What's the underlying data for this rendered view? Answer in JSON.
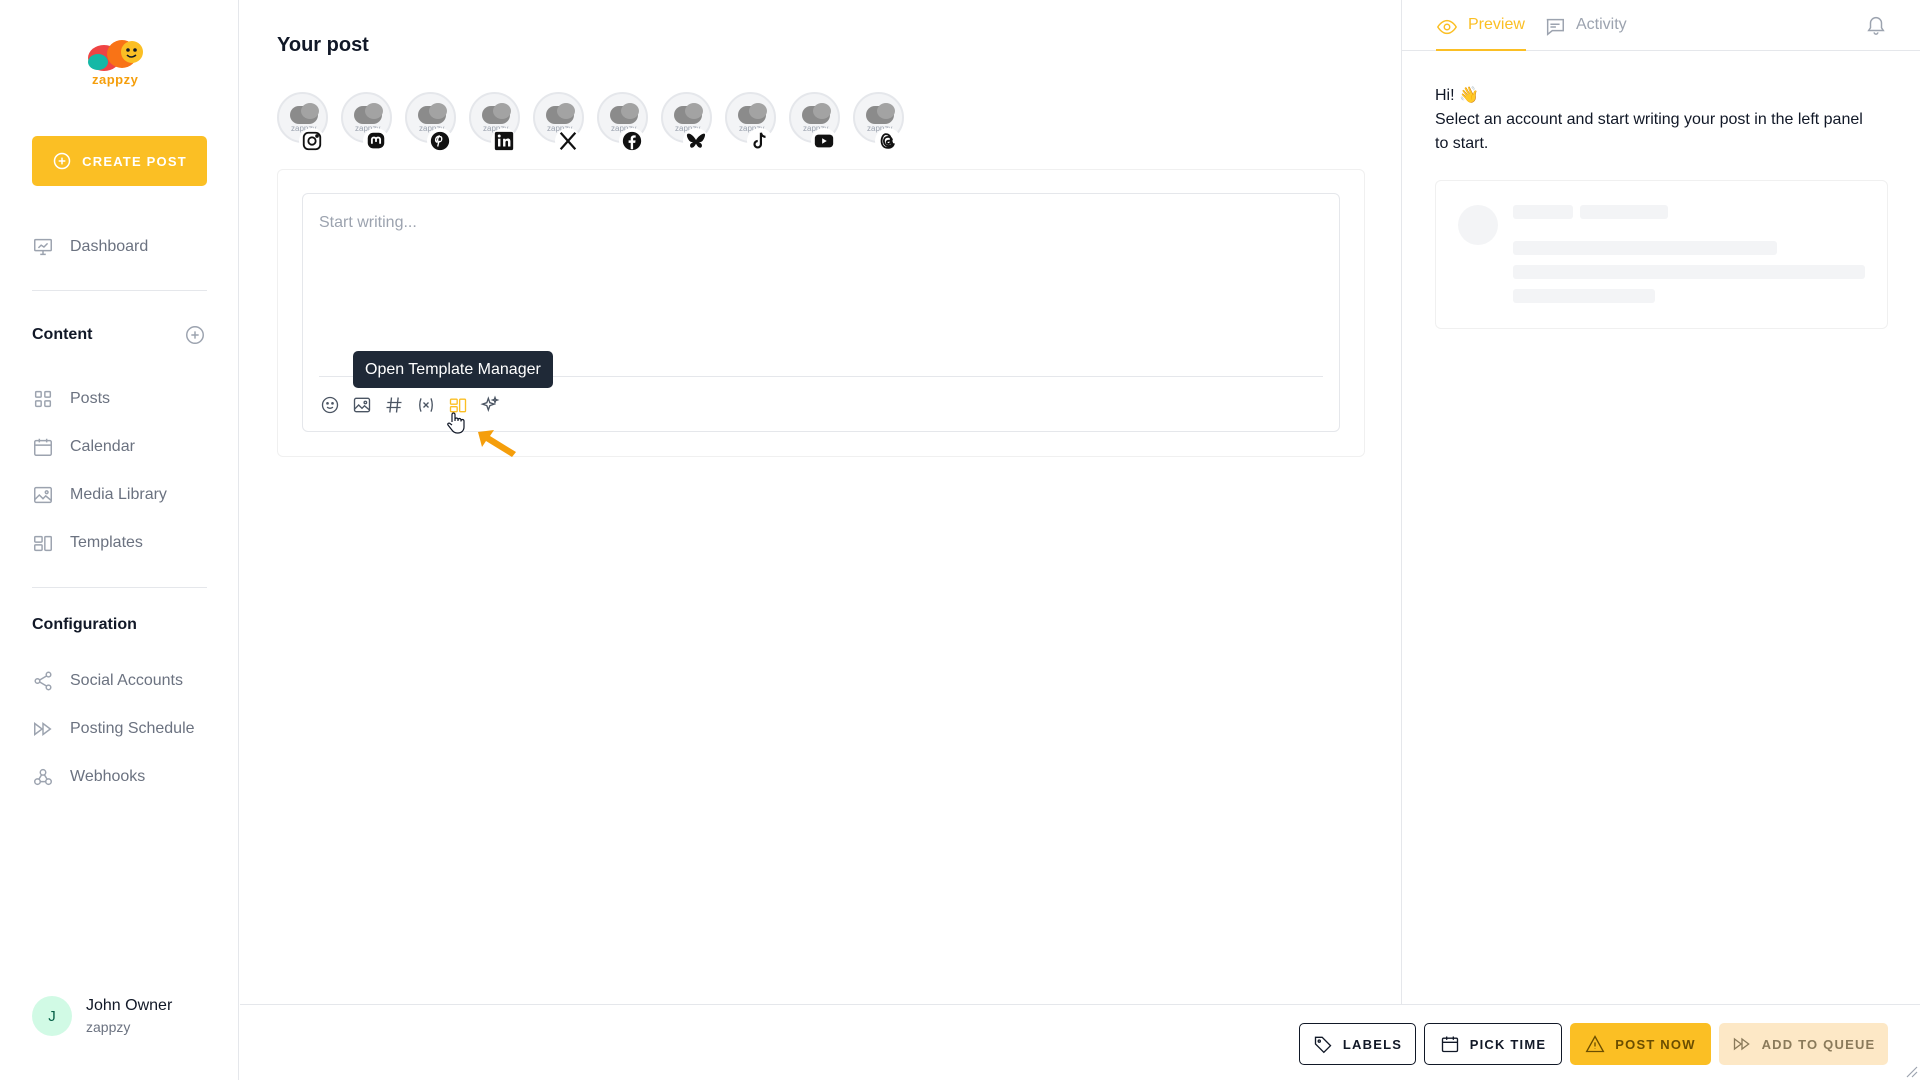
{
  "brand": {
    "name": "zappzy",
    "accent": "#fbbf24"
  },
  "sidebar": {
    "create_label": "CREATE POST",
    "dashboard_label": "Dashboard",
    "content_title": "Content",
    "content_items": [
      {
        "label": "Posts",
        "icon": "grid-icon"
      },
      {
        "label": "Calendar",
        "icon": "calendar-icon"
      },
      {
        "label": "Media Library",
        "icon": "image-icon"
      },
      {
        "label": "Templates",
        "icon": "template-icon"
      }
    ],
    "config_title": "Configuration",
    "config_items": [
      {
        "label": "Social Accounts",
        "icon": "share-icon"
      },
      {
        "label": "Posting Schedule",
        "icon": "fast-forward-icon"
      },
      {
        "label": "Webhooks",
        "icon": "webhook-icon"
      }
    ],
    "user": {
      "initial": "J",
      "name": "John Owner",
      "org": "zappzy"
    }
  },
  "main": {
    "title": "Your post",
    "accounts": [
      {
        "network": "instagram",
        "avatar_text": "zappzy"
      },
      {
        "network": "mastodon",
        "avatar_text": "zappzy"
      },
      {
        "network": "pinterest",
        "avatar_text": "zappzy"
      },
      {
        "network": "linkedin",
        "avatar_text": "zappzy"
      },
      {
        "network": "x",
        "avatar_text": "zappzy"
      },
      {
        "network": "facebook",
        "avatar_text": "zappzy"
      },
      {
        "network": "bluesky",
        "avatar_text": "zappzy"
      },
      {
        "network": "tiktok",
        "avatar_text": "zappzy"
      },
      {
        "network": "youtube",
        "avatar_text": "zappzy"
      },
      {
        "network": "threads",
        "avatar_text": "zappzy"
      }
    ],
    "editor_placeholder": "Start writing...",
    "tooltip": "Open Template Manager"
  },
  "right_panel": {
    "tabs": [
      {
        "label": "Preview",
        "icon": "eye-icon",
        "active": true
      },
      {
        "label": "Activity",
        "icon": "comment-icon",
        "active": false
      }
    ],
    "greeting_line1": "Hi! 👋",
    "greeting_line2": "Select an account and start writing your post in the left panel to start."
  },
  "footer": {
    "labels_btn": "LABELS",
    "pick_time_btn": "PICK TIME",
    "post_now_btn": "POST NOW",
    "add_queue_btn": "ADD TO QUEUE"
  }
}
